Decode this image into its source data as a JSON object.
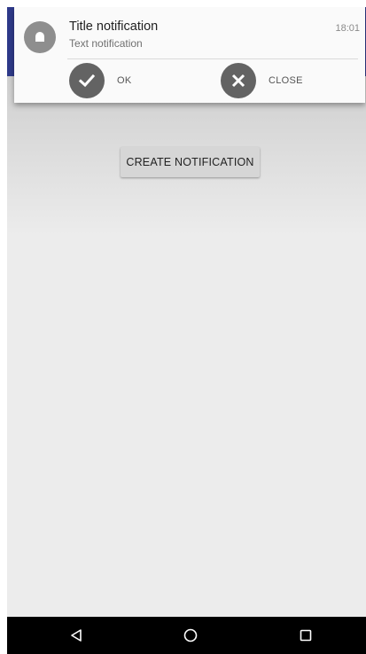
{
  "notification": {
    "title": "Title notification",
    "text": "Text notification",
    "time": "18:01",
    "actions": [
      {
        "label": "OK",
        "icon": "check-icon"
      },
      {
        "label": "CLOSE",
        "icon": "close-icon"
      }
    ]
  },
  "main": {
    "create_button_label": "CREATE NOTIFICATION"
  },
  "navbar": {
    "back_icon": "back-triangle-icon",
    "home_icon": "home-circle-icon",
    "recent_icon": "recent-square-icon"
  },
  "colors": {
    "app_bar": "#2f3a8a",
    "background": "#ececec",
    "navbar": "#000000"
  }
}
